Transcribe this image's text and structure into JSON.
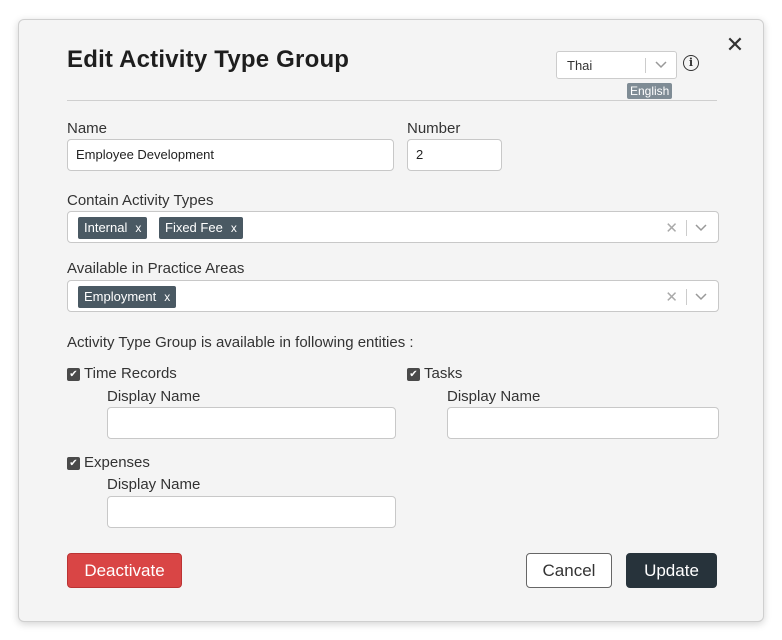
{
  "dialog": {
    "title": "Edit Activity Type Group",
    "close_icon": "close-icon"
  },
  "language": {
    "selected": "Thai",
    "badge": "English",
    "info_icon": "info-icon"
  },
  "fields": {
    "name_label": "Name",
    "name_value": "Employee Development",
    "number_label": "Number",
    "number_value": "2",
    "activity_types_label": "Contain Activity Types",
    "activity_types": [
      "Internal",
      "Fixed Fee"
    ],
    "practice_areas_label": "Available in Practice Areas",
    "practice_areas": [
      "Employment"
    ],
    "tag_remove": "x",
    "clear_icon": "✕"
  },
  "entities": {
    "heading": "Activity Type Group is available in following entities :",
    "time_records": {
      "label": "Time Records",
      "checked": true,
      "display_name_label": "Display Name",
      "display_name_value": ""
    },
    "tasks": {
      "label": "Tasks",
      "checked": true,
      "display_name_label": "Display Name",
      "display_name_value": ""
    },
    "expenses": {
      "label": "Expenses",
      "checked": true,
      "display_name_label": "Display Name",
      "display_name_value": ""
    },
    "check_glyph": "✔"
  },
  "buttons": {
    "deactivate": "Deactivate",
    "cancel": "Cancel",
    "update": "Update"
  },
  "colors": {
    "deactivate": "#d94545",
    "update": "#27333b",
    "tag": "#4a5963",
    "badge": "#7f8c95"
  }
}
